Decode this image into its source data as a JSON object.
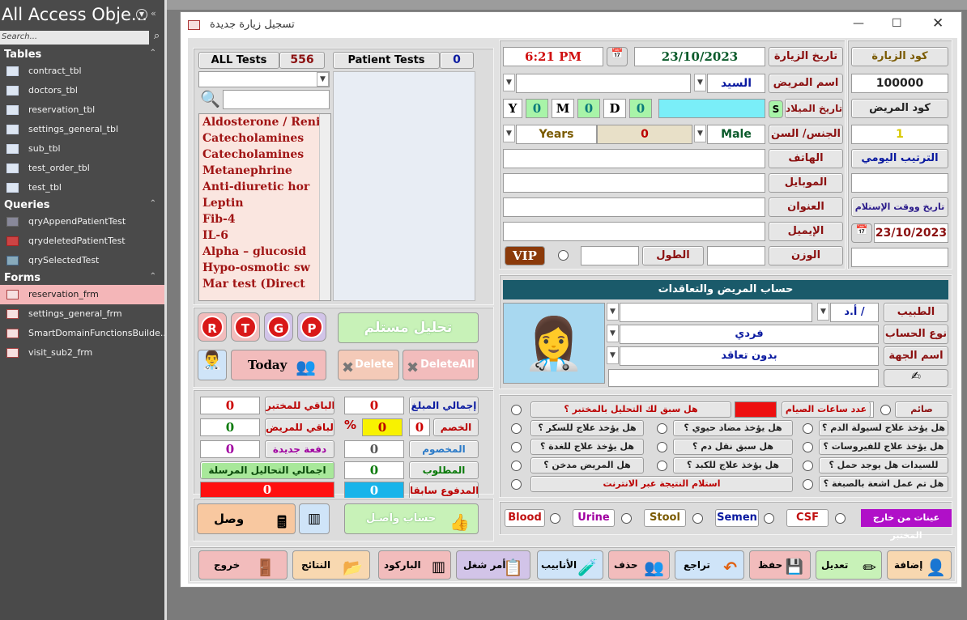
{
  "nav": {
    "title": "All Access Obje...",
    "search_placeholder": "Search...",
    "tables_label": "Tables",
    "tables": [
      "contract_tbl",
      "doctors_tbl",
      "reservation_tbl",
      "settings_general_tbl",
      "sub_tbl",
      "test_order_tbl",
      "test_tbl"
    ],
    "queries_label": "Queries",
    "queries": [
      "qryAppendPatientTest",
      "qrydeletedPatientTest",
      "qrySelectedTest"
    ],
    "forms_label": "Forms",
    "forms": [
      "reservation_frm",
      "settings_general_frm",
      "SmartDomainFunctionsBuilde...",
      "visit_sub2_frm"
    ],
    "selected_form": "reservation_frm"
  },
  "window": {
    "title": "تسجيل زيارة جديدة"
  },
  "visit": {
    "time": "6:21 PM",
    "date": "23/10/2023",
    "date_label": "تاريخ الزيارة",
    "code_label": "كود الزيارة",
    "code": "100000"
  },
  "patient": {
    "name_label": "اسم المريض",
    "title": "السيد",
    "patient_code_label": "كود المريض",
    "birth_label": "تاريخ الميلاد",
    "s_btn": "S",
    "y": "Y",
    "m": "M",
    "d": "D",
    "y_val": "0",
    "m_val": "0",
    "d_val": "0",
    "daily_order": "1",
    "gender_age_label": "الجنس/ السن",
    "gender": "Male",
    "age": "0",
    "age_unit": "Years",
    "daily_order_label": "الترتيب اليومي",
    "phone_label": "الهاتف",
    "mobile_label": "الموبايل",
    "address_label": "العنوان",
    "email_label": "الإيميل",
    "receive_label": "تاريخ ووقت الإستلام",
    "receive_date": "23/10/2023",
    "weight_label": "الوزن",
    "height_label": "الطول",
    "vip": "VIP"
  },
  "tests": {
    "all_label": "ALL Tests",
    "all_count": "556",
    "patient_label": "Patient Tests",
    "patient_count": "0",
    "list": [
      "Aldosterone / Reni",
      "Catecholamines",
      "Catecholamines",
      "Metanephrine",
      "Anti-diuretic hor",
      "Leptin",
      "Fib-4",
      "IL-6",
      "Alpha – glucosid",
      "Hypo-osmotic sw",
      "Mar test (Direct"
    ]
  },
  "buttons": {
    "r": "R",
    "t": "T",
    "g": "G",
    "p": "P",
    "received": "تحليل مستلم",
    "today": "Today",
    "delete": "Delete",
    "delete_all": "DeleteAll"
  },
  "account": {
    "header": "حساب المريض والتعاقدات",
    "doctor_label": "الطبيب",
    "doctor_title": "أ.د /",
    "account_type_label": "نوع الحساب",
    "account_type": "فردي",
    "entity_label": "اسم الجهة",
    "entity": "بدون تعاقد"
  },
  "finance": {
    "lab_remaining_label": "الباقي للمختبر",
    "lab_remaining": "0",
    "patient_remaining_label": "الباقي للمريض",
    "patient_remaining": "0",
    "new_payment_label": "دفعة جديدة",
    "new_payment": "0",
    "sent_tests_label": "اجمالي التحاليل المرسلة",
    "sent_tests": "0",
    "total_label": "إجمالي المبلغ",
    "total": "0",
    "discount_label": "الخصم",
    "discount": "0",
    "discount_pct": "0",
    "percent": "%",
    "deducted_label": "المخصوم",
    "deducted": "0",
    "required_label": "المطلوب",
    "required": "0",
    "prepaid_label": "المدفوع سابقا",
    "prepaid": "0",
    "receipt": "وصل",
    "account_received": "حساب واصـل"
  },
  "questions": {
    "fasting": "صائم",
    "fasting_hours": "عدد ساعات الصيام",
    "prev_test": "هل سبق لك التحليل بالمختبر ؟",
    "rows": [
      [
        "هل يؤخذ علاج لسيولة الدم ؟",
        "هل يؤخذ مضاد حيوي ؟",
        "هل يؤخذ علاج للسكر ؟"
      ],
      [
        "هل يؤخذ علاج للفيروسات ؟",
        "هل سبق نقل دم ؟",
        "هل يؤخذ علاج للغدة ؟"
      ],
      [
        "للسيدات هل يوجد حمل ؟",
        "هل يؤخذ علاج للكبد ؟",
        "هل المريض مدخن ؟"
      ]
    ],
    "dye": "هل تم عمل اشعة بالصبغة ؟",
    "online": "استلام النتيجة عبر الانترنت"
  },
  "samples": {
    "outside": "عينات من خارج المختبر",
    "items": [
      "Blood",
      "Urine",
      "Stool",
      "Semen",
      "CSF"
    ]
  },
  "footer": [
    "إضافة",
    "تعديل",
    "حفظ",
    "تراجع",
    "حذف",
    "الأنابيب",
    "أمر شغل",
    "الباركود",
    "النتائج",
    "خروج"
  ]
}
